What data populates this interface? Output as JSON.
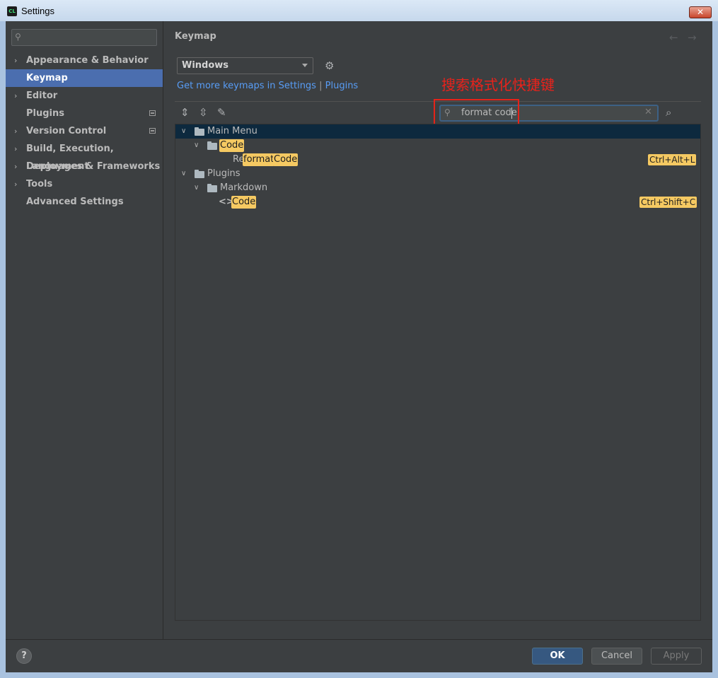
{
  "window": {
    "title": "Settings",
    "app_icon": "CL"
  },
  "sidebar": {
    "search_placeholder": "",
    "items": [
      {
        "label": "Appearance & Behavior",
        "expandable": true
      },
      {
        "label": "Keymap",
        "selected": true
      },
      {
        "label": "Editor",
        "expandable": true
      },
      {
        "label": "Plugins"
      },
      {
        "label": "Version Control",
        "expandable": true
      },
      {
        "label": "Build, Execution, Deployment",
        "expandable": true
      },
      {
        "label": "Languages & Frameworks",
        "expandable": true
      },
      {
        "label": "Tools",
        "expandable": true
      },
      {
        "label": "Advanced Settings"
      }
    ]
  },
  "main": {
    "title": "Keymap",
    "keymap_select": "Windows",
    "links": {
      "text": "Get more keymaps in Settings",
      "sep": "|",
      "plugins": "Plugins"
    },
    "annotation": "搜索格式化快捷键",
    "search": {
      "value": "format code"
    },
    "tree": {
      "main_menu": "Main Menu",
      "code_folder": "Code",
      "reformat_prefix": "Re",
      "reformat_hl1": "format",
      "reformat_hl2": "Code",
      "reformat_shortcut": "Ctrl+Alt+L",
      "plugins": "Plugins",
      "markdown": "Markdown",
      "md_code": "Code",
      "md_shortcut": "Ctrl+Shift+C"
    }
  },
  "footer": {
    "help": "?",
    "ok": "OK",
    "cancel": "Cancel",
    "apply": "Apply"
  },
  "colors": {
    "accent": "#4b6eaf",
    "highlight": "#f5c962",
    "annotation": "#e8221b",
    "background": "#3c3f41"
  }
}
